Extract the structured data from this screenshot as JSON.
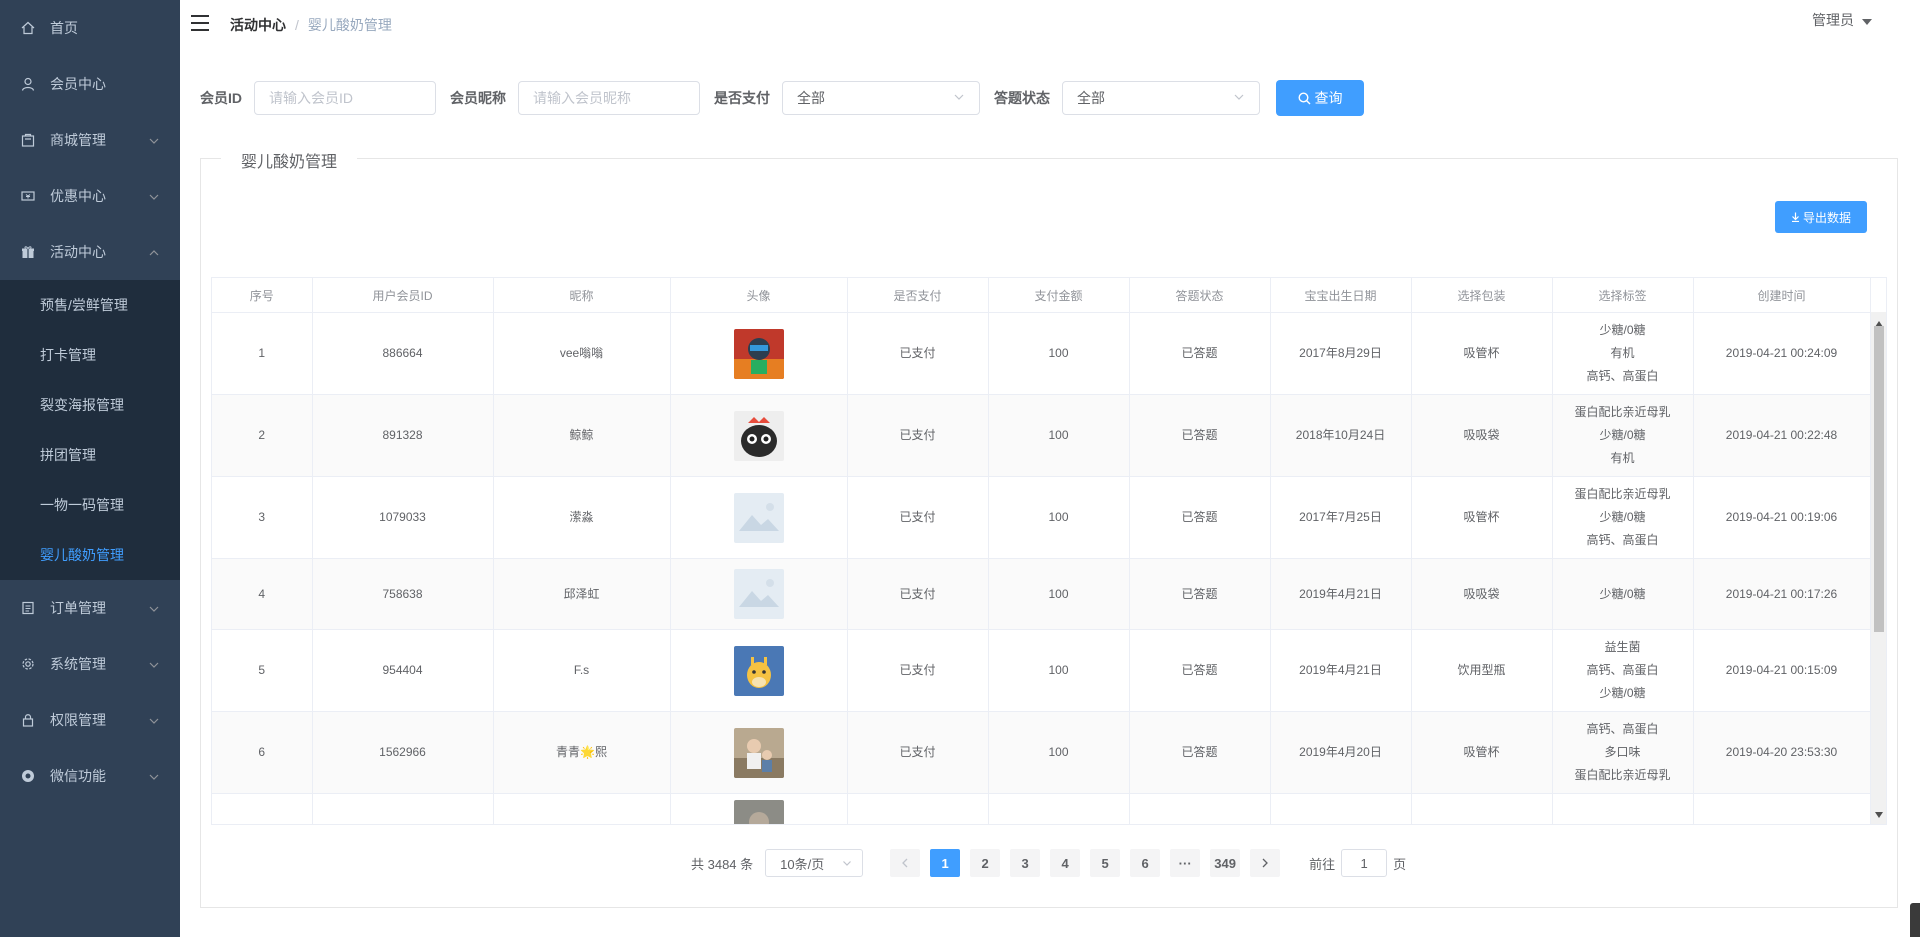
{
  "sidebar": {
    "items": [
      {
        "label": "首页",
        "icon": "home-icon",
        "expandable": false
      },
      {
        "label": "会员中心",
        "icon": "user-icon",
        "expandable": false
      },
      {
        "label": "商城管理",
        "icon": "shop-icon",
        "expandable": true
      },
      {
        "label": "优惠中心",
        "icon": "ticket-icon",
        "expandable": true
      },
      {
        "label": "活动中心",
        "icon": "gift-icon",
        "expandable": true,
        "expanded": true
      },
      {
        "label": "订单管理",
        "icon": "document-icon",
        "expandable": true
      },
      {
        "label": "系统管理",
        "icon": "gear-icon",
        "expandable": true
      },
      {
        "label": "权限管理",
        "icon": "lock-icon",
        "expandable": true
      },
      {
        "label": "微信功能",
        "icon": "wechat-icon",
        "expandable": true
      }
    ],
    "activity_submenu": [
      "预售/尝鲜管理",
      "打卡管理",
      "裂变海报管理",
      "拼团管理",
      "一物一码管理",
      "婴儿酸奶管理"
    ],
    "active_submenu": "婴儿酸奶管理"
  },
  "header": {
    "breadcrumb": [
      "活动中心",
      "婴儿酸奶管理"
    ],
    "user": "管理员"
  },
  "filters": {
    "member_id_label": "会员ID",
    "member_id_placeholder": "请输入会员ID",
    "nickname_label": "会员昵称",
    "nickname_placeholder": "请输入会员昵称",
    "paid_label": "是否支付",
    "paid_value": "全部",
    "answer_label": "答题状态",
    "answer_value": "全部",
    "query_button": "查询"
  },
  "panel": {
    "title": "婴儿酸奶管理",
    "export_button": "导出数据"
  },
  "table": {
    "columns": [
      "序号",
      "用户会员ID",
      "昵称",
      "头像",
      "是否支付",
      "支付金额",
      "答题状态",
      "宝宝出生日期",
      "选择包装",
      "选择标签",
      "创建时间"
    ],
    "rows": [
      {
        "index": "1",
        "member_id": "886664",
        "nickname": "vee嗡嗡",
        "avatar": "cartoon-avatar",
        "paid": "已支付",
        "amount": "100",
        "answer": "已答题",
        "birth": "2017年8月29日",
        "package": "吸管杯",
        "tags": [
          "少糖/0糖",
          "有机",
          "高钙、高蛋白"
        ],
        "created": "2019-04-21 00:24:09"
      },
      {
        "index": "2",
        "member_id": "891328",
        "nickname": "鲸鲸",
        "avatar": "cat-avatar",
        "paid": "已支付",
        "amount": "100",
        "answer": "已答题",
        "birth": "2018年10月24日",
        "package": "吸吸袋",
        "tags": [
          "蛋白配比亲近母乳",
          "少糖/0糖",
          "有机"
        ],
        "created": "2019-04-21 00:22:48"
      },
      {
        "index": "3",
        "member_id": "1079033",
        "nickname": "潆淼",
        "avatar": "placeholder-avatar",
        "paid": "已支付",
        "amount": "100",
        "answer": "已答题",
        "birth": "2017年7月25日",
        "package": "吸管杯",
        "tags": [
          "蛋白配比亲近母乳",
          "少糖/0糖",
          "高钙、高蛋白"
        ],
        "created": "2019-04-21 00:19:06"
      },
      {
        "index": "4",
        "member_id": "758638",
        "nickname": "邱泽虹",
        "avatar": "placeholder-avatar",
        "paid": "已支付",
        "amount": "100",
        "answer": "已答题",
        "birth": "2019年4月21日",
        "package": "吸吸袋",
        "tags": [
          "少糖/0糖"
        ],
        "created": "2019-04-21 00:17:26"
      },
      {
        "index": "5",
        "member_id": "954404",
        "nickname": "F.s",
        "avatar": "giraffe-avatar",
        "paid": "已支付",
        "amount": "100",
        "answer": "已答题",
        "birth": "2019年4月21日",
        "package": "饮用型瓶",
        "tags": [
          "益生菌",
          "高钙、高蛋白",
          "少糖/0糖"
        ],
        "created": "2019-04-21 00:15:09"
      },
      {
        "index": "6",
        "member_id": "1562966",
        "nickname": "青青🌟熙",
        "avatar": "photo-avatar",
        "paid": "已支付",
        "amount": "100",
        "answer": "已答题",
        "birth": "2019年4月20日",
        "package": "吸管杯",
        "tags": [
          "高钙、高蛋白",
          "多口味",
          "蛋白配比亲近母乳"
        ],
        "created": "2019-04-20 23:53:30"
      }
    ]
  },
  "pagination": {
    "total": "共 3484 条",
    "page_size": "10条/页",
    "pages": [
      "1",
      "2",
      "3",
      "4",
      "5",
      "6",
      "···",
      "349"
    ],
    "current": "1",
    "goto_label": "前往",
    "goto_value": "1",
    "goto_suffix": "页"
  },
  "colors": {
    "sidebar_bg": "#304156",
    "submenu_bg": "#1f2d3d",
    "accent": "#409eff",
    "sidebar_text": "#bfcbd9"
  }
}
